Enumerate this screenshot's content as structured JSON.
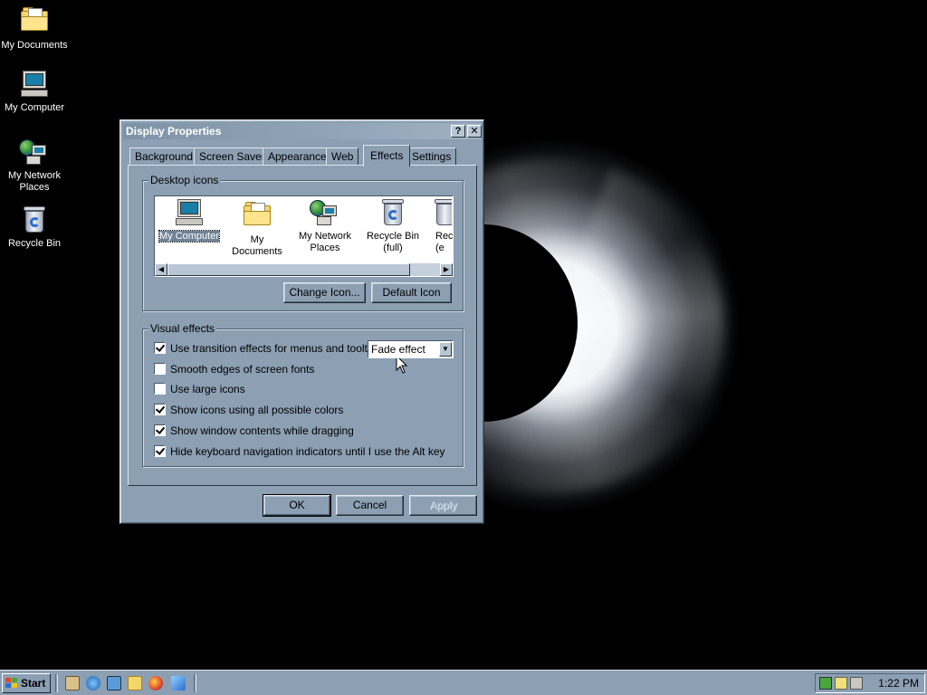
{
  "desktop": {
    "icons": [
      {
        "label": "My Documents"
      },
      {
        "label": "My Computer"
      },
      {
        "label": "My Network Places"
      },
      {
        "label": "Recycle Bin"
      }
    ]
  },
  "dialog": {
    "title": "Display Properties",
    "help_glyph": "?",
    "close_glyph": "✕",
    "tabs": [
      {
        "label": "Background"
      },
      {
        "label": "Screen Saver"
      },
      {
        "label": "Appearance"
      },
      {
        "label": "Web"
      },
      {
        "label": "Effects",
        "active": true
      },
      {
        "label": "Settings"
      }
    ],
    "desktop_icons": {
      "group_label": "Desktop icons",
      "items": [
        {
          "label": "My Computer",
          "selected": true,
          "icon": "computer-icon"
        },
        {
          "label": "My Documents",
          "icon": "folder-icon"
        },
        {
          "label": "My Network Places",
          "icon": "network-icon"
        },
        {
          "label": "Recycle Bin (full)",
          "icon": "recycle-bin-full-icon"
        },
        {
          "label": "Rec (e",
          "icon": "recycle-bin-empty-icon"
        }
      ],
      "change_icon_button": "Change Icon...",
      "default_icon_button": "Default Icon"
    },
    "visual_effects": {
      "group_label": "Visual effects",
      "options": [
        {
          "label": "Use transition effects for menus and tooltips",
          "checked": true
        },
        {
          "label": "Smooth edges of screen fonts",
          "checked": false
        },
        {
          "label": "Use large icons",
          "checked": false
        },
        {
          "label": "Show icons using all possible colors",
          "checked": true
        },
        {
          "label": "Show window contents while dragging",
          "checked": true
        },
        {
          "label": "Hide keyboard navigation indicators until I use the Alt key",
          "checked": true
        }
      ],
      "transition_effect_value": "Fade effect"
    },
    "buttons": {
      "ok": "OK",
      "cancel": "Cancel",
      "apply": "Apply"
    }
  },
  "taskbar": {
    "start_label": "Start",
    "clock": "1:22 PM"
  },
  "colors": {
    "window_face": "#8c9fb3",
    "selection": "#6f8296",
    "desktop": "#000000"
  }
}
